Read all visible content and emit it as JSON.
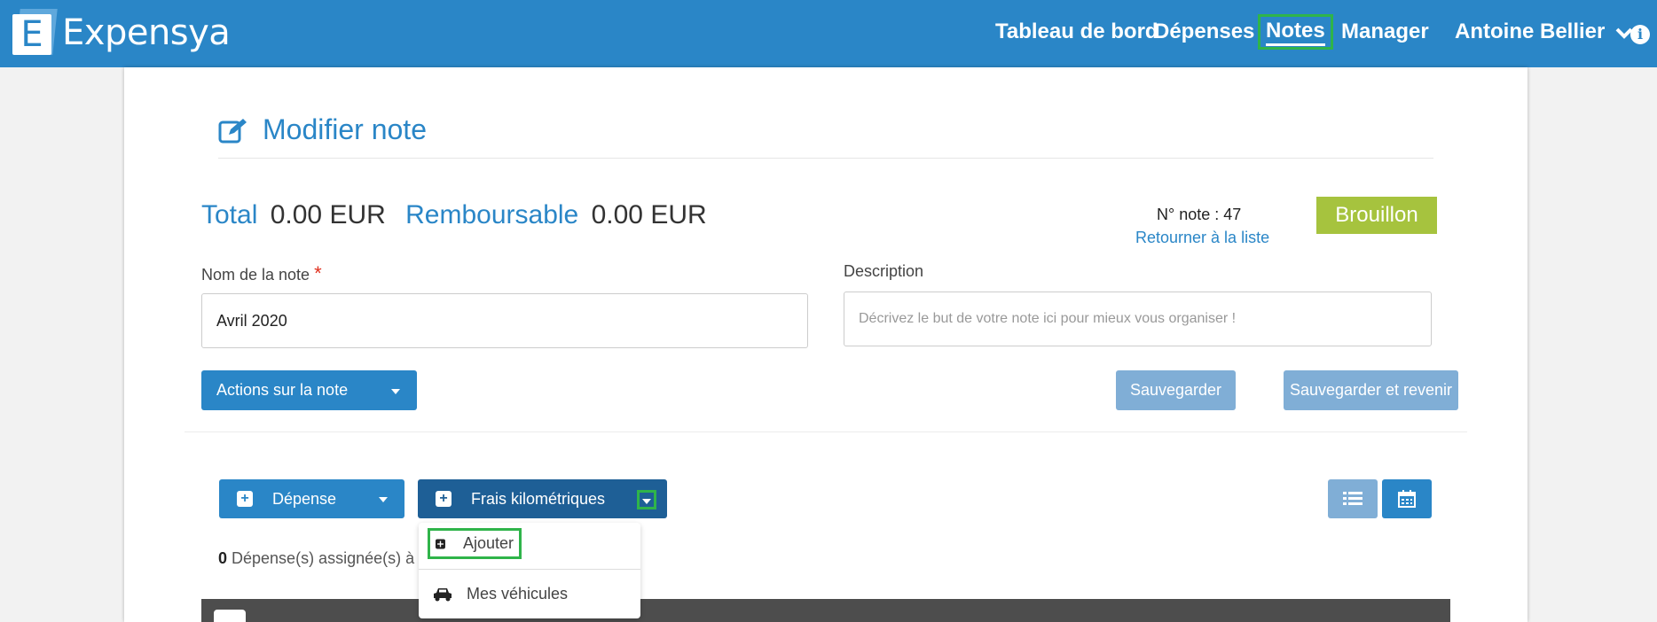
{
  "app": {
    "brand": "Expensya",
    "logo_letter": "E"
  },
  "nav": {
    "items": [
      "Tableau de bord",
      "Dépenses",
      "Notes",
      "Manager"
    ],
    "user": "Antoine Bellier",
    "active": "Notes"
  },
  "page": {
    "title": "Modifier note",
    "total_label": "Total",
    "total_value": "0.00 EUR",
    "refund_label": "Remboursable",
    "refund_value": "0.00 EUR",
    "note_number": "N° note : 47",
    "back_link": "Retourner à la liste",
    "status": "Brouillon"
  },
  "form": {
    "name_label": "Nom de la note",
    "name_required": "*",
    "name_value": "Avril 2020",
    "description_label": "Description",
    "description_placeholder": "Décrivez le but de votre note ici pour mieux vous organiser !"
  },
  "actions": {
    "note_actions": "Actions sur la note",
    "save": "Sauvegarder",
    "save_return": "Sauvegarder et revenir"
  },
  "expenses": {
    "add_expense": "Dépense",
    "mileage": "Frais kilométriques",
    "dropdown": [
      "Ajouter",
      "Mes véhicules"
    ],
    "count_value": "0",
    "count_text": " Dépense(s) assignée(s) à cett"
  },
  "colors": {
    "primary": "#2a86c7",
    "draft": "#a6c33e",
    "highlight": "#2fb44a",
    "table_head": "#4d4d4d"
  }
}
